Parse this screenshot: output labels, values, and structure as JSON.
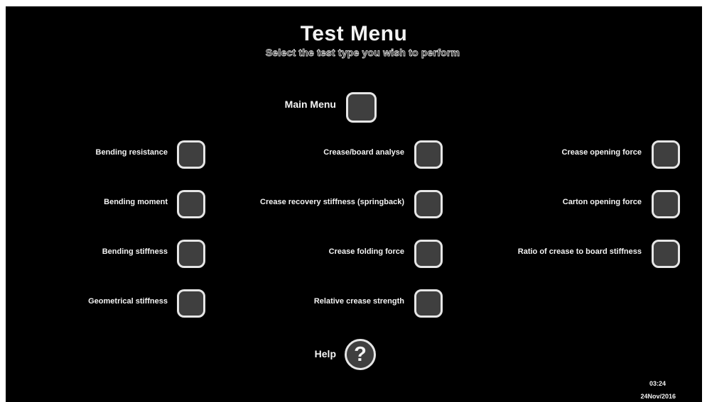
{
  "header": {
    "title": "Test Menu",
    "subtitle": "Select the test type you wish to perform"
  },
  "main_menu": {
    "label": "Main Menu"
  },
  "tests": {
    "left": [
      {
        "label": "Bending resistance"
      },
      {
        "label": "Bending moment"
      },
      {
        "label": "Bending stiffness"
      },
      {
        "label": "Geometrical stiffness"
      }
    ],
    "middle": [
      {
        "label": "Crease/board analyse"
      },
      {
        "label": "Crease recovery stiffness (springback)"
      },
      {
        "label": "Crease folding force"
      },
      {
        "label": "Relative crease strength"
      }
    ],
    "right": [
      {
        "label": "Crease opening force"
      },
      {
        "label": "Carton opening force"
      },
      {
        "label": "Ratio of crease to board stiffness"
      }
    ]
  },
  "help": {
    "label": "Help",
    "icon": "question-mark-icon",
    "glyph": "?"
  },
  "status": {
    "time": "03:24",
    "date": "24Nov/2016"
  },
  "colors": {
    "background": "#000000",
    "button_fill": "#3f3f3f",
    "button_border": "#e6e6e6",
    "text": "#f4f4f4"
  }
}
